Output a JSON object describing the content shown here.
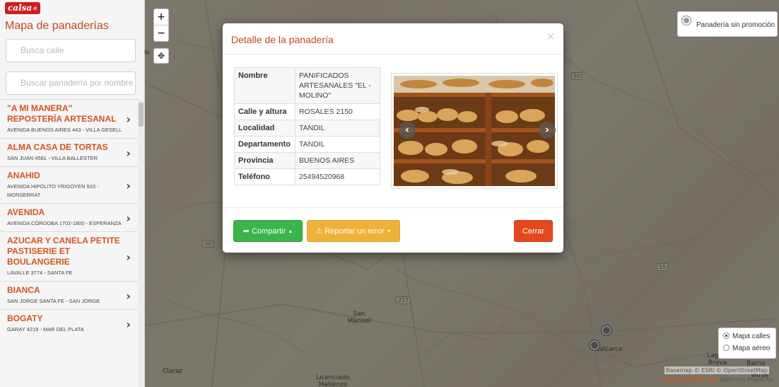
{
  "sidebar": {
    "brand": "calsa",
    "title": "Mapa de panaderías",
    "street_placeholder": "Busca calle",
    "bakery_placeholder": "Buscar panadería por nombre o",
    "items": [
      {
        "name": "\"A MI MANERA\" REPOSTERÍA ARTESANAL",
        "address": "AVENIDA BUENOS AIRES 443 - VILLA GESELL"
      },
      {
        "name": "ALMA CASA DE TORTAS",
        "address": "SAN JUAN 4581 - VILLA BALLESTER"
      },
      {
        "name": "ANAHID",
        "address": "AVENIDA HIPÓLITO YRIGOYEN 910 - MONSERRAT"
      },
      {
        "name": "AVENIDA",
        "address": "AVENIDA CÓRDOBA 1702-1800 - ESPERANZA"
      },
      {
        "name": "AZUCAR Y CANELA PETITE PASTISERIE ET BOULANGERIE",
        "address": "LAVALLE 3774 - SANTA FE"
      },
      {
        "name": "BIANCA",
        "address": "SAN JORGE SANTA FE - SAN JORGE"
      },
      {
        "name": "BOGATY",
        "address": "GARAY 4219 - MAR DEL PLATA"
      }
    ]
  },
  "map": {
    "zoom_in": "+",
    "zoom_out": "−",
    "cut_label": "le",
    "legend_label": "Panadería sin promoción",
    "basemap_options": [
      {
        "label": "Mapa calles",
        "selected": true
      },
      {
        "label": "Mapa aéreo",
        "selected": false
      }
    ],
    "attribution": "Basemap © ESRI © OpenStreetMap",
    "credit_prefix": "Desarrollado por",
    "credit_name": "Sistemas Mapache",
    "places": [
      "San Manuel",
      "Claraz",
      "Licenciado Matienzo",
      "Balcarce",
      "Laguna Brava",
      "Barrio",
      "Verde"
    ],
    "routes": [
      "30",
      "227",
      "55",
      "50"
    ]
  },
  "modal": {
    "title": "Detalle de la panadería",
    "close": "×",
    "fields": [
      {
        "label": "Nombre",
        "value": "PANIFICADOS ARTESANALES \"EL - MOLINO\""
      },
      {
        "label": "Calle y altura",
        "value": "ROSALES 2150"
      },
      {
        "label": "Localidad",
        "value": "TANDIL"
      },
      {
        "label": "Departamento",
        "value": "TANDIL"
      },
      {
        "label": "Provincia",
        "value": "BUENOS AIRES"
      },
      {
        "label": "Teléfono",
        "value": "25494520968"
      }
    ],
    "buttons": {
      "share": "Compartir",
      "report": "Reportar un error",
      "close": "Cerrar"
    },
    "colors": {
      "title": "#c04a1c",
      "share": "#3bb44a",
      "report": "#eeb23a",
      "close": "#e4491d"
    }
  }
}
